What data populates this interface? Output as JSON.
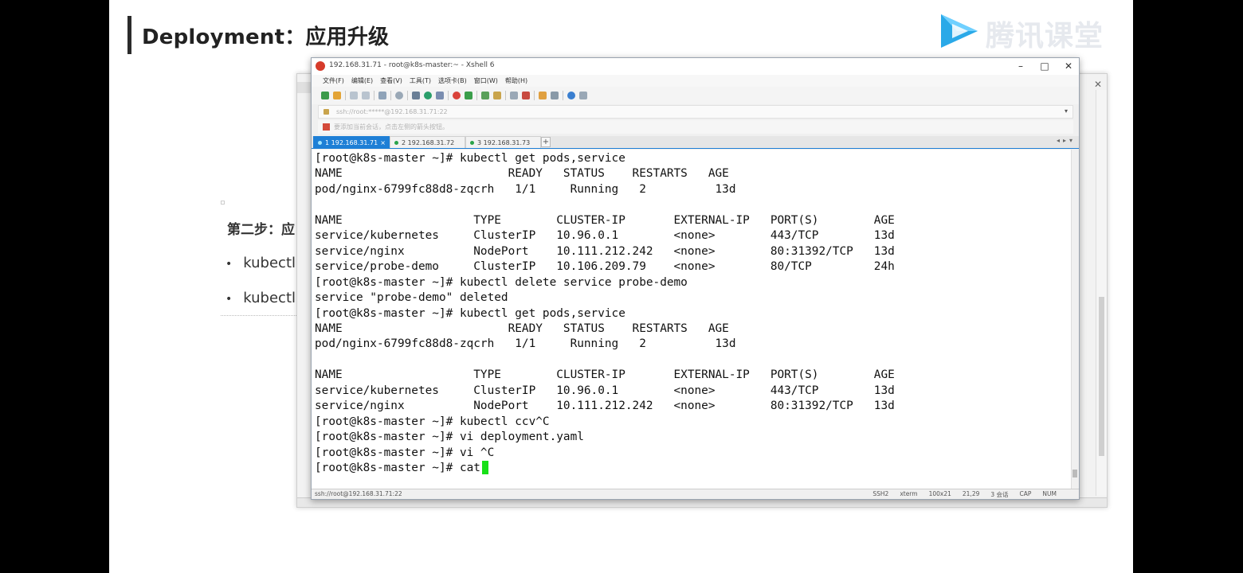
{
  "slide": {
    "title": "Deployment：应用升级",
    "brand_text": "腾讯课堂",
    "brand_color": "#2aa9e8",
    "peek_step": "第二步：应",
    "peek_bullets": [
      "kubectl",
      "kubectl"
    ]
  },
  "xshell": {
    "title": "192.168.31.71 - root@k8s-master:~ - Xshell 6",
    "window_buttons": [
      "–",
      "□",
      "✕"
    ],
    "menu": [
      "文件(F)",
      "编辑(E)",
      "查看(V)",
      "工具(T)",
      "选项卡(B)",
      "窗口(W)",
      "帮助(H)"
    ],
    "address": "ssh://root:*****@192.168.31.71:22",
    "hint": "要添加当前会话，点击左侧的箭头按钮。",
    "tabs": [
      {
        "label": "1 192.168.31.71",
        "active": true
      },
      {
        "label": "2 192.168.31.72",
        "active": false
      },
      {
        "label": "3 192.168.31.73",
        "active": false
      }
    ],
    "terminal_lines": [
      "[root@k8s-master ~]# kubectl get pods,service",
      "NAME                        READY   STATUS    RESTARTS   AGE",
      "pod/nginx-6799fc88d8-zqcrh   1/1     Running   2          13d",
      "",
      "NAME                   TYPE        CLUSTER-IP       EXTERNAL-IP   PORT(S)        AGE",
      "service/kubernetes     ClusterIP   10.96.0.1        <none>        443/TCP        13d",
      "service/nginx          NodePort    10.111.212.242   <none>        80:31392/TCP   13d",
      "service/probe-demo     ClusterIP   10.106.209.79    <none>        80/TCP         24h",
      "[root@k8s-master ~]# kubectl delete service probe-demo",
      "service \"probe-demo\" deleted",
      "[root@k8s-master ~]# kubectl get pods,service",
      "NAME                        READY   STATUS    RESTARTS   AGE",
      "pod/nginx-6799fc88d8-zqcrh   1/1     Running   2          13d",
      "",
      "NAME                   TYPE        CLUSTER-IP       EXTERNAL-IP   PORT(S)        AGE",
      "service/kubernetes     ClusterIP   10.96.0.1        <none>        443/TCP        13d",
      "service/nginx          NodePort    10.111.212.242   <none>        80:31392/TCP   13d",
      "[root@k8s-master ~]# kubectl ccv^C",
      "[root@k8s-master ~]# vi deployment.yaml",
      "[root@k8s-master ~]# vi ^C",
      "[root@k8s-master ~]# cat"
    ],
    "status_left": "ssh://root@192.168.31.71:22",
    "status_right": [
      "SSH2",
      "xterm",
      "100x21",
      "21,29",
      "3 会话",
      "CAP",
      "NUM"
    ]
  }
}
